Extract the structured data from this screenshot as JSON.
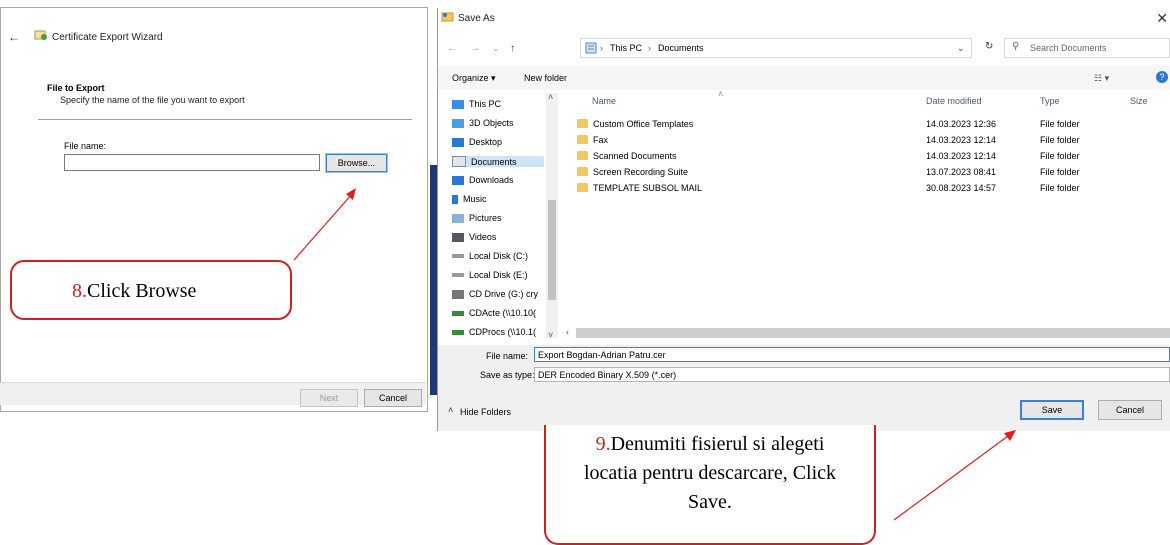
{
  "wizard": {
    "title": "Certificate Export Wizard",
    "section_title": "File to Export",
    "section_desc": "Specify the name of the file you want to export",
    "filename_label": "File name:",
    "filename_value": "",
    "browse_label": "Browse...",
    "next_label": "Next",
    "cancel_label": "Cancel"
  },
  "callout8": {
    "number": "8.",
    "text": "Click Browse"
  },
  "saveas": {
    "title": "Save As",
    "breadcrumb": [
      "This PC",
      "Documents"
    ],
    "search_placeholder": "Search Documents",
    "organize_label": "Organize ▾",
    "new_folder_label": "New folder",
    "nav": [
      {
        "label": "This PC",
        "icon": "pc-icon"
      },
      {
        "label": "3D Objects",
        "icon": "cube-icon"
      },
      {
        "label": "Desktop",
        "icon": "desktop-icon"
      },
      {
        "label": "Documents",
        "icon": "documents-icon"
      },
      {
        "label": "Downloads",
        "icon": "download-icon"
      },
      {
        "label": "Music",
        "icon": "music-icon"
      },
      {
        "label": "Pictures",
        "icon": "pictures-icon"
      },
      {
        "label": "Videos",
        "icon": "video-icon"
      },
      {
        "label": "Local Disk (C:)",
        "icon": "disk-icon"
      },
      {
        "label": "Local Disk (E:)",
        "icon": "disk-icon"
      },
      {
        "label": "CD Drive (G:) cry",
        "icon": "cd-icon"
      },
      {
        "label": "CDActe (\\\\10.10(",
        "icon": "network-drive-icon"
      },
      {
        "label": "CDProcs (\\\\10.1(",
        "icon": "network-drive-icon"
      }
    ],
    "columns": {
      "name": "Name",
      "date": "Date modified",
      "type": "Type",
      "size": "Size"
    },
    "files": [
      {
        "name": "Custom Office Templates",
        "date": "14.03.2023 12:36",
        "type": "File folder"
      },
      {
        "name": "Fax",
        "date": "14.03.2023 12:14",
        "type": "File folder"
      },
      {
        "name": "Scanned Documents",
        "date": "14.03.2023 12:14",
        "type": "File folder"
      },
      {
        "name": "Screen Recording Suite",
        "date": "13.07.2023 08:41",
        "type": "File folder"
      },
      {
        "name": "TEMPLATE SUBSOL MAIL",
        "date": "30.08.2023 14:57",
        "type": "File folder"
      }
    ],
    "filename_label": "File name:",
    "filename_value": "Export Bogdan-Adrian Patru.cer",
    "savetype_label": "Save as type:",
    "savetype_value": "DER Encoded Binary X.509 (*.cer)",
    "hide_folders_label": "Hide Folders",
    "save_label": "Save",
    "cancel_label": "Cancel"
  },
  "callout9": {
    "number": "9.",
    "text": "Denumiti fisierul si alegeti locatia pentru descarcare, Click Save."
  },
  "colors": {
    "accent": "#3c7fd6",
    "callout": "#cc2222",
    "folder": "#f4c760"
  }
}
